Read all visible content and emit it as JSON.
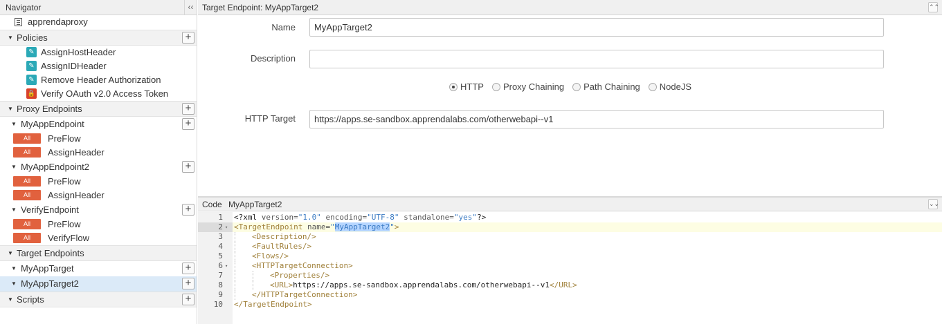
{
  "navigator": {
    "title": "Navigator",
    "collapse_icon": "‹‹",
    "proxy_name": "apprendaproxy",
    "sections": {
      "policies": "Policies",
      "proxy_endpoints": "Proxy Endpoints",
      "target_endpoints": "Target Endpoints",
      "scripts": "Scripts"
    },
    "policies": [
      {
        "label": "AssignHostHeader",
        "icon": "edit-policy-icon"
      },
      {
        "label": "AssignIDHeader",
        "icon": "edit-policy-icon"
      },
      {
        "label": "Remove Header Authorization",
        "icon": "edit-policy-icon"
      },
      {
        "label": "Verify OAuth v2.0 Access Token",
        "icon": "lock-policy-icon"
      }
    ],
    "proxy_endpoints": [
      {
        "name": "MyAppEndpoint",
        "flows": [
          {
            "badge": "All",
            "label": "PreFlow"
          },
          {
            "badge": "All",
            "label": "AssignHeader"
          }
        ]
      },
      {
        "name": "MyAppEndpoint2",
        "flows": [
          {
            "badge": "All",
            "label": "PreFlow"
          },
          {
            "badge": "All",
            "label": "AssignHeader"
          }
        ]
      },
      {
        "name": "VerifyEndpoint",
        "flows": [
          {
            "badge": "All",
            "label": "PreFlow"
          },
          {
            "badge": "All",
            "label": "VerifyFlow"
          }
        ]
      }
    ],
    "target_endpoints": [
      {
        "name": "MyAppTarget",
        "selected": false
      },
      {
        "name": "MyAppTarget2",
        "selected": true
      }
    ],
    "plus_icon": "+"
  },
  "target_panel": {
    "title": "Target Endpoint: MyAppTarget2",
    "collapse_icon": "⌃⌃",
    "name_label": "Name",
    "name_value": "MyAppTarget2",
    "description_label": "Description",
    "description_value": "",
    "radio_options": [
      {
        "label": "HTTP",
        "checked": true
      },
      {
        "label": "Proxy Chaining",
        "checked": false
      },
      {
        "label": "Path Chaining",
        "checked": false
      },
      {
        "label": "NodeJS",
        "checked": false
      }
    ],
    "http_target_label": "HTTP Target",
    "http_target_value": "https://apps.se-sandbox.apprendalabs.com/otherwebapi--v1"
  },
  "code_panel": {
    "label": "Code",
    "title": "MyAppTarget2",
    "expand_icon": "⌄⌄",
    "active_line": 2,
    "lines": [
      {
        "n": "1",
        "fold": "",
        "indent": 0,
        "parts": [
          {
            "c": "tx",
            "t": "<?xml "
          },
          {
            "c": "at",
            "t": "version="
          },
          {
            "c": "av",
            "t": "\"1.0\""
          },
          {
            "c": "at",
            "t": " encoding="
          },
          {
            "c": "av",
            "t": "\"UTF-8\""
          },
          {
            "c": "at",
            "t": " standalone="
          },
          {
            "c": "av",
            "t": "\"yes\""
          },
          {
            "c": "tx",
            "t": "?>"
          }
        ]
      },
      {
        "n": "2",
        "fold": "▾",
        "indent": 0,
        "parts": [
          {
            "c": "t",
            "t": "<TargetEndpoint "
          },
          {
            "c": "at",
            "t": "name="
          },
          {
            "c": "av",
            "t": "\""
          },
          {
            "c": "av sel",
            "t": "MyAppTarget2"
          },
          {
            "c": "av",
            "t": "\""
          },
          {
            "c": "t",
            "t": ">"
          }
        ]
      },
      {
        "n": "3",
        "fold": "",
        "indent": 1,
        "parts": [
          {
            "c": "t",
            "t": "<Description/>"
          }
        ]
      },
      {
        "n": "4",
        "fold": "",
        "indent": 1,
        "parts": [
          {
            "c": "t",
            "t": "<FaultRules/>"
          }
        ]
      },
      {
        "n": "5",
        "fold": "",
        "indent": 1,
        "parts": [
          {
            "c": "t",
            "t": "<Flows/>"
          }
        ]
      },
      {
        "n": "6",
        "fold": "▾",
        "indent": 1,
        "parts": [
          {
            "c": "t",
            "t": "<HTTPTargetConnection>"
          }
        ]
      },
      {
        "n": "7",
        "fold": "",
        "indent": 2,
        "parts": [
          {
            "c": "t",
            "t": "<Properties/>"
          }
        ]
      },
      {
        "n": "8",
        "fold": "",
        "indent": 2,
        "parts": [
          {
            "c": "t",
            "t": "<URL>"
          },
          {
            "c": "tx",
            "t": "https://apps.se-sandbox.apprendalabs.com/otherwebapi--v1"
          },
          {
            "c": "t",
            "t": "</URL>"
          }
        ]
      },
      {
        "n": "9",
        "fold": "",
        "indent": 1,
        "parts": [
          {
            "c": "t",
            "t": "</HTTPTargetConnection>"
          }
        ]
      },
      {
        "n": "10",
        "fold": "",
        "indent": 0,
        "parts": [
          {
            "c": "t",
            "t": "</TargetEndpoint>"
          }
        ]
      }
    ]
  }
}
